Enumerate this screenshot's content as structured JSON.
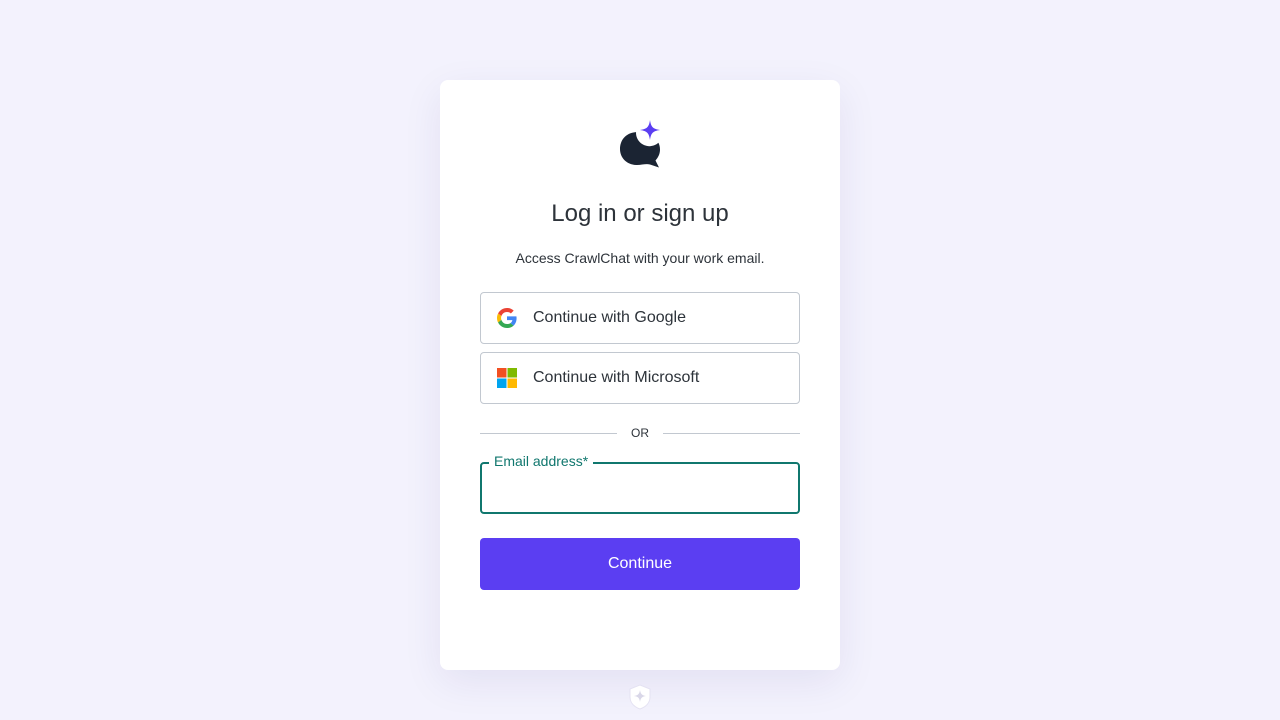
{
  "page": {
    "title": "Log in or sign up",
    "subtitle": "Access CrawlChat with your work email."
  },
  "social": {
    "google_label": "Continue with Google",
    "microsoft_label": "Continue with Microsoft"
  },
  "divider": {
    "text": "OR"
  },
  "email": {
    "label": "Email address*",
    "value": "",
    "placeholder": ""
  },
  "actions": {
    "continue_label": "Continue"
  },
  "icons": {
    "logo": "chat-bubble-sparkle-icon",
    "google": "google-icon",
    "microsoft": "microsoft-icon",
    "footer": "shield-badge-icon"
  },
  "colors": {
    "background": "#f3f2fd",
    "accent": "#5b3ef2",
    "focus": "#10776e",
    "text": "#2d333a",
    "logo_dark": "#1b2433"
  }
}
